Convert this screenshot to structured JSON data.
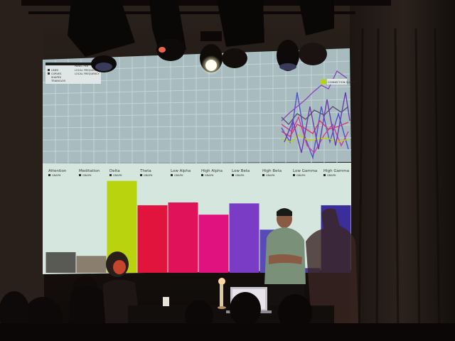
{
  "scene": {
    "description_colors": {
      "room": "#1a1410",
      "screen_grid": "#a9bcc0",
      "screen_lower": "#d6e8df"
    }
  },
  "screen": {
    "legend": {
      "items": [
        "LINES",
        "CURVES",
        "SHAPES",
        "TRIANGLES"
      ],
      "side_items": [
        "PANEL PER",
        "LOCAL FREQUENCY",
        "LOCAL FREQUENCY"
      ]
    },
    "graph_badge": "CONNECTION QUALITY",
    "bands": [
      {
        "label": "Attention",
        "sub": "GRAPH",
        "color": "#5a5a54",
        "level": 0.22
      },
      {
        "label": "Meditation",
        "sub": "GRAPH",
        "color": "#8a7e6e",
        "level": 0.18
      },
      {
        "label": "Delta",
        "sub": "GRAPH",
        "color": "#b9d40e",
        "level": 0.98
      },
      {
        "label": "Theta",
        "sub": "GRAPH",
        "color": "#e0143c",
        "level": 0.72
      },
      {
        "label": "Low Alpha",
        "sub": "GRAPH",
        "color": "#e0125a",
        "level": 0.75
      },
      {
        "label": "High Alpha",
        "sub": "GRAPH",
        "color": "#e01280",
        "level": 0.62
      },
      {
        "label": "Low Beta",
        "sub": "GRAPH",
        "color": "#7a3cc4",
        "level": 0.74
      },
      {
        "label": "High Beta",
        "sub": "GRAPH",
        "color": "#5a4ab8",
        "level": 0.46
      },
      {
        "label": "Low Gamma",
        "sub": "GRAPH",
        "color": "#473ca8",
        "level": 0.05
      },
      {
        "label": "High Gamma",
        "sub": "GRAPH",
        "color": "#3c2e9a",
        "level": 0.72
      }
    ]
  }
}
